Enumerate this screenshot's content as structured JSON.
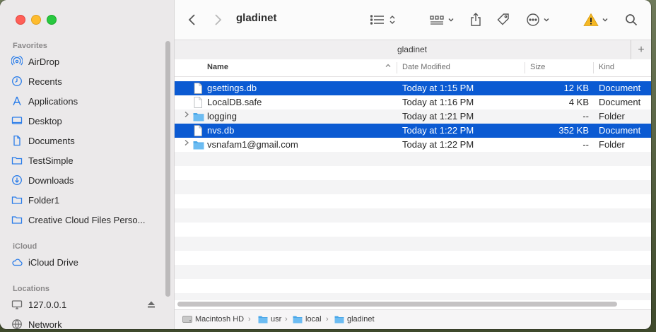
{
  "window": {
    "title": "gladinet",
    "tab_title": "gladinet"
  },
  "sidebar": {
    "favorites_header": "Favorites",
    "favorites": [
      {
        "label": "AirDrop",
        "icon": "airdrop-icon"
      },
      {
        "label": "Recents",
        "icon": "clock-icon"
      },
      {
        "label": "Applications",
        "icon": "applications-icon"
      },
      {
        "label": "Desktop",
        "icon": "desktop-icon"
      },
      {
        "label": "Documents",
        "icon": "document-icon"
      },
      {
        "label": "TestSimple",
        "icon": "folder-icon"
      },
      {
        "label": "Downloads",
        "icon": "download-icon"
      },
      {
        "label": "Folder1",
        "icon": "folder-icon"
      },
      {
        "label": "Creative Cloud Files Perso...",
        "icon": "folder-icon"
      }
    ],
    "icloud_header": "iCloud",
    "icloud": [
      {
        "label": "iCloud Drive",
        "icon": "cloud-icon"
      }
    ],
    "locations_header": "Locations",
    "locations": [
      {
        "label": "127.0.0.1",
        "icon": "display-icon"
      },
      {
        "label": "Network",
        "icon": "network-icon"
      }
    ]
  },
  "columns": {
    "name": "Name",
    "date": "Date Modified",
    "size": "Size",
    "kind": "Kind"
  },
  "files": [
    {
      "name": "gsettings.db",
      "date": "Today at 1:15 PM",
      "size": "12 KB",
      "kind": "Document",
      "type": "file",
      "selected": true
    },
    {
      "name": "LocalDB.safe",
      "date": "Today at 1:16 PM",
      "size": "4 KB",
      "kind": "Document",
      "type": "file",
      "selected": false
    },
    {
      "name": "logging",
      "date": "Today at 1:21 PM",
      "size": "--",
      "kind": "Folder",
      "type": "folder",
      "selected": false
    },
    {
      "name": "nvs.db",
      "date": "Today at 1:22 PM",
      "size": "352 KB",
      "kind": "Document",
      "type": "file",
      "selected": true
    },
    {
      "name": "vsnafam1@gmail.com",
      "date": "Today at 1:22 PM",
      "size": "--",
      "kind": "Folder",
      "type": "folder",
      "selected": false
    }
  ],
  "path": [
    {
      "label": "Macintosh HD",
      "icon": "hard-drive-icon"
    },
    {
      "label": "usr",
      "icon": "folder-icon"
    },
    {
      "label": "local",
      "icon": "folder-icon"
    },
    {
      "label": "gladinet",
      "icon": "folder-icon"
    }
  ],
  "colors": {
    "accent": "#2b7de9",
    "selection": "#0b5ad2",
    "folder": "#4aa7e8"
  }
}
